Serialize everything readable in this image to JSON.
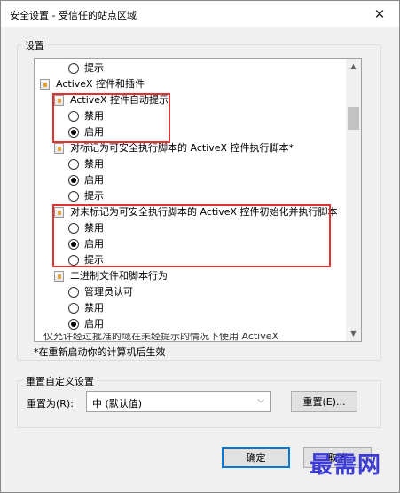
{
  "window": {
    "title": "安全设置 - 受信任的站点区域",
    "close_glyph": "✕"
  },
  "settings_group": {
    "label": "设置"
  },
  "settings_list": [
    {
      "kind": "radio",
      "label": "提示",
      "checked": false
    },
    {
      "kind": "category",
      "label": "ActiveX 控件和插件"
    },
    {
      "kind": "setting",
      "label": "ActiveX 控件自动提示"
    },
    {
      "kind": "radio",
      "label": "禁用",
      "checked": false
    },
    {
      "kind": "radio",
      "label": "启用",
      "checked": true
    },
    {
      "kind": "setting",
      "label": "对标记为可安全执行脚本的 ActiveX 控件执行脚本*"
    },
    {
      "kind": "radio",
      "label": "禁用",
      "checked": false
    },
    {
      "kind": "radio",
      "label": "启用",
      "checked": true
    },
    {
      "kind": "radio",
      "label": "提示",
      "checked": false
    },
    {
      "kind": "setting",
      "label": "对未标记为可安全执行脚本的 ActiveX 控件初始化并执行脚本"
    },
    {
      "kind": "radio",
      "label": "禁用",
      "checked": false
    },
    {
      "kind": "radio",
      "label": "启用",
      "checked": true
    },
    {
      "kind": "radio",
      "label": "提示",
      "checked": false
    },
    {
      "kind": "setting",
      "label": "二进制文件和脚本行为"
    },
    {
      "kind": "radio",
      "label": "管理员认可",
      "checked": false
    },
    {
      "kind": "radio",
      "label": "禁用",
      "checked": false
    },
    {
      "kind": "radio",
      "label": "启用",
      "checked": true
    }
  ],
  "cut_off_row": "仅允许经过批准的域在未经提示的情况下使用 ActiveX",
  "scrollbar": {
    "up_glyph": "▲",
    "down_glyph": "▼"
  },
  "restart_note": "*在重新启动你的计算机后生效",
  "reset_group": {
    "label": "重置自定义设置",
    "field_label": "重置为(R):",
    "selected_value": "中 (默认值)",
    "dropdown_glyph": "⌵",
    "reset_button": "重置(E)..."
  },
  "footer": {
    "ok_button": "确定",
    "cancel_button": "取消"
  },
  "watermark": "最需网",
  "colors": {
    "highlight_box": "#e03232",
    "watermark": "#3c3bd6"
  }
}
